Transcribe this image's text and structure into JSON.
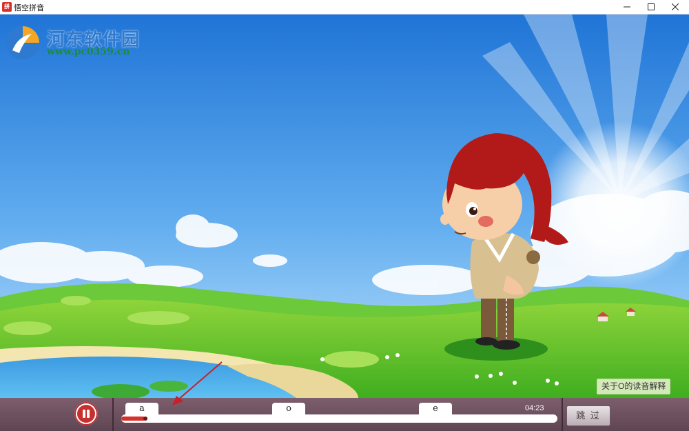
{
  "window": {
    "app_icon_text": "拼",
    "title": "悟空拼音"
  },
  "watermark": {
    "title": "河东软件园",
    "url": "www.pc0359.cn"
  },
  "tooltip": "关于O的读音解释",
  "player": {
    "letters": [
      "a",
      "o",
      "e"
    ],
    "time": "04:23",
    "progress_fraction": 0.055,
    "skip_label": "跳 过"
  },
  "colors": {
    "accent_red": "#d7312b",
    "sky": "#3d8be0",
    "bar": "#6a4f5d"
  },
  "icons": {
    "pause": "pause-icon",
    "minimize": "minimize-icon",
    "maximize": "maximize-icon",
    "close": "close-icon"
  }
}
